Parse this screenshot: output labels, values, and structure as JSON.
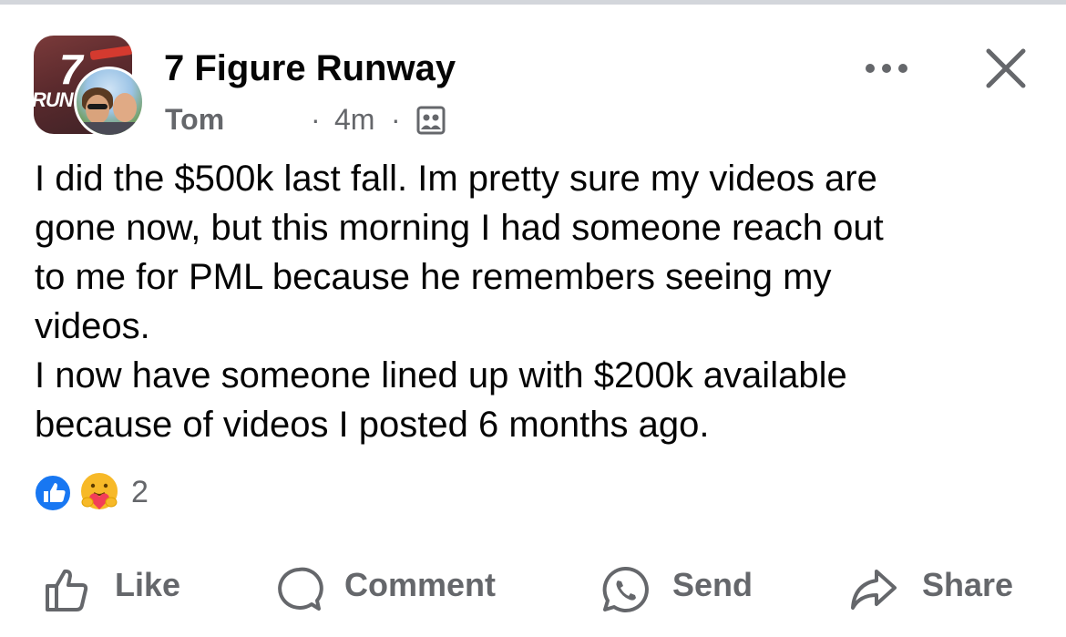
{
  "post": {
    "group_name": "7 Figure Runway",
    "author": "Tom",
    "separator": "·",
    "time_ago": "4m",
    "privacy_icon": "group-members-icon",
    "body_lines": [
      "I did the $500k last fall.  Im pretty sure my videos are",
      "gone now, but this morning I had someone reach out",
      "to me for PML because he remembers seeing my",
      "videos.",
      "I now have someone lined up with $200k available",
      "because of videos I posted 6 months ago."
    ],
    "reactions": {
      "icons": [
        "like-icon",
        "care-icon"
      ],
      "count": "2"
    }
  },
  "header_icons": {
    "more": "more-dots-icon",
    "close": "close-icon"
  },
  "actions": {
    "like": "Like",
    "comment": "Comment",
    "send": "Send",
    "share": "Share"
  },
  "colors": {
    "text_primary": "#050505",
    "text_secondary": "#65676b",
    "like_blue": "#1877f2",
    "care_yellow": "#f7b928",
    "care_red": "#f33e58"
  }
}
